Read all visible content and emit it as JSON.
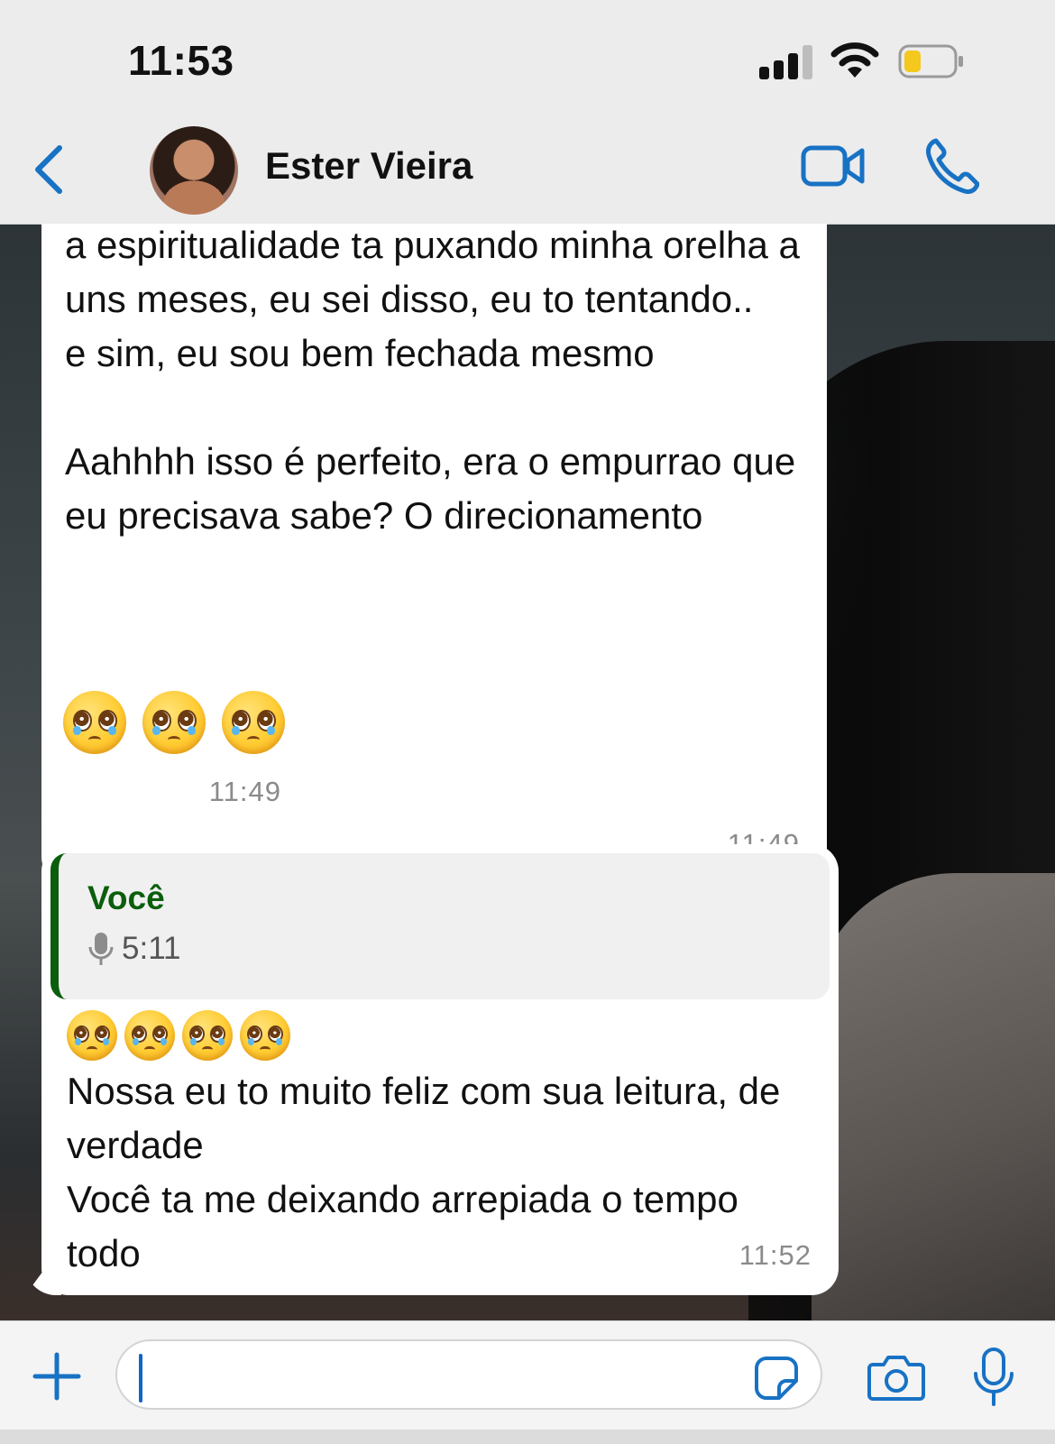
{
  "status_bar": {
    "time": "11:53",
    "signal_bars_filled": 3,
    "signal_bars_total": 4,
    "battery_level": 0.35,
    "battery_color": "#f4c81c"
  },
  "header": {
    "contact_name": "Ester Vieira",
    "back_icon": "chevron-left-icon",
    "video_icon": "video-camera-icon",
    "call_icon": "phone-icon",
    "accent_color": "#1872c4"
  },
  "messages": [
    {
      "text": "a espiritualidade ta puxando minha orelha a uns meses, eu sei disso, eu to tentando..\ne sim, eu sou bem fechada mesmo\n\nAahhhh isso é perfeito, era o empurrao que eu precisava sabe? O direcionamento",
      "time": "11:49"
    },
    {
      "emoji": "🥹🥹🥹",
      "time": "11:49"
    },
    {
      "quote": {
        "author": "Você",
        "voice_icon": "microphone-icon",
        "duration": "5:11",
        "author_color": "#0a5e0c"
      },
      "emoji": "🥹🥹🥹🥹",
      "text": "Nossa eu to muito feliz com sua leitura, de verdade\nVocê ta me deixando arrepiada o tempo todo",
      "time": "11:52"
    }
  ],
  "input_bar": {
    "plus_icon": "plus-icon",
    "sticker_icon": "sticker-icon",
    "camera_icon": "camera-icon",
    "mic_icon": "microphone-icon",
    "message_value": ""
  }
}
